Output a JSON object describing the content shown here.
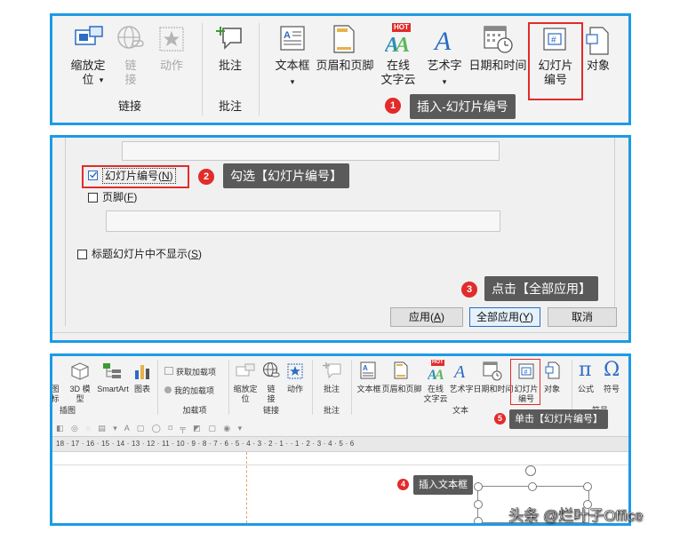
{
  "panel1": {
    "zoom_label": "缩放定\n位",
    "link_label": "链\n接",
    "action_label": "动作",
    "comment_label": "批注",
    "group_link": "链接",
    "group_comment": "批注",
    "textbox_label": "文本框",
    "header_footer_label": "页眉和页脚",
    "wordcloud_label": "在线\n文字云",
    "hot_badge": "HOT",
    "wordart_label": "艺术字",
    "datetime_label": "日期和时间",
    "slide_number_label": "幻灯片\n编号",
    "object_label": "对象",
    "dropdown_arrow": "▾",
    "callout_num": "1",
    "callout_text": "插入-幻灯片编号"
  },
  "panel2": {
    "slide_number_checkbox": "幻灯片编号(",
    "slide_number_key": "N",
    "footer_checkbox": "页脚(",
    "footer_key": "F",
    "hide_title_checkbox": "标题幻灯片中不显示(",
    "hide_title_key": "S",
    "close_paren": ")",
    "callout2_num": "2",
    "callout2_text": "勾选【幻灯片编号】",
    "callout3_num": "3",
    "callout3_text": "点击【全部应用】",
    "apply_btn": "应用(",
    "apply_key": "A",
    "apply_all_btn": "全部应用(",
    "apply_all_key": "Y",
    "cancel_btn": "取消"
  },
  "panel3": {
    "icons_label": "图\n标",
    "model3d_label": "3D 模\n型",
    "smartart_label": "SmartArt",
    "chart_label": "图表",
    "group_illustration": "插图",
    "get_addin": "获取加载项",
    "my_addin": "我的加载项",
    "group_addin": "加载项",
    "zoom_label": "缩放定\n位",
    "link_label": "链\n接",
    "action_label": "动作",
    "group_link": "链接",
    "comment_label": "批注",
    "group_comment": "批注",
    "textbox_label": "文本框",
    "header_footer_label": "页眉和页脚",
    "wordcloud_label": "在线\n文字云",
    "wordart_label": "艺术字",
    "datetime_label": "日期和时间",
    "slide_number_label": "幻灯片\n编号",
    "object_label": "对象",
    "group_text": "文本",
    "formula_label": "公式",
    "symbol_label": "符号",
    "group_symbol": "符号",
    "hot_badge": "HOT",
    "ruler_text": "18 · 17 · 16 · 15 · 14 · 13 · 12 · 11 · 10 · 9 · 8 · 7 · 6 · 5 · 4 · 3 · 2 · 1 ·  · 1 · 2 · 3 · 4 · 5 · 6",
    "callout5_num": "5",
    "callout5_text": "单击【幻灯片编号】",
    "callout4_num": "4",
    "callout4_text": "插入文本框"
  },
  "watermark": "头条 @烂叶子Office",
  "colors": {
    "frame": "#1c9be6",
    "marker": "#e22b2b",
    "callout_bg": "#5a5a5a",
    "accent_blue": "#2b6cc4"
  }
}
